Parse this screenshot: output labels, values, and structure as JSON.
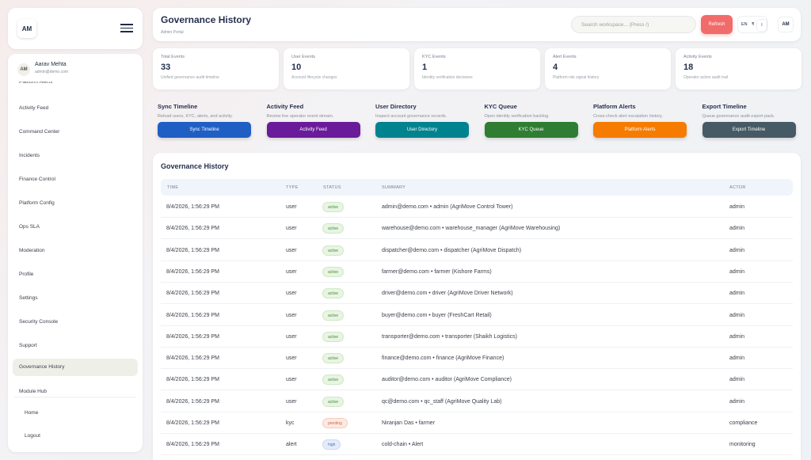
{
  "brand": {
    "logo": "AM",
    "menu_icon": "hamburger-icon"
  },
  "user": {
    "initials": "AM",
    "name": "Aarav Mehta",
    "email": "admin@demo.com"
  },
  "sidebar": {
    "cut_item": "Platform Alerts",
    "items": [
      {
        "label": "Activity Feed"
      },
      {
        "label": "Command Center"
      },
      {
        "label": "Incidents"
      },
      {
        "label": "Finance Control"
      },
      {
        "label": "Platform Config"
      },
      {
        "label": "Ops SLA"
      },
      {
        "label": "Moderation"
      },
      {
        "label": "Profile"
      },
      {
        "label": "Settings"
      },
      {
        "label": "Security Console"
      },
      {
        "label": "Support"
      },
      {
        "label": "Governance History",
        "active": true
      },
      {
        "label": "Module Hub"
      }
    ],
    "bottom": [
      {
        "label": "Home"
      },
      {
        "label": "Logout"
      }
    ]
  },
  "header": {
    "title": "Governance History",
    "subtitle": "Admin Portal",
    "search_placeholder": "Search workspace... (Press /)",
    "refresh_label": "Refresh",
    "lang": "EN",
    "currency": "₹",
    "currency_sub": "I",
    "avatar": "AM"
  },
  "stats": [
    {
      "label": "Total Events",
      "value": "33",
      "desc": "Unified governance audit timeline"
    },
    {
      "label": "User Events",
      "value": "10",
      "desc": "Account lifecycle changes"
    },
    {
      "label": "KYC Events",
      "value": "1",
      "desc": "Identity verification decisions"
    },
    {
      "label": "Alert Events",
      "value": "4",
      "desc": "Platform risk signal history"
    },
    {
      "label": "Activity Events",
      "value": "18",
      "desc": "Operator action audit trail"
    }
  ],
  "actions": [
    {
      "title": "Sync Timeline",
      "desc": "Reload users, KYC, alerts, and activity.",
      "button": "Sync Timeline",
      "color": "#1f5fc4"
    },
    {
      "title": "Activity Feed",
      "desc": "Review live operator event stream.",
      "button": "Activity Feed",
      "color": "#6a1b9a"
    },
    {
      "title": "User Directory",
      "desc": "Inspect account governance records.",
      "button": "User Directory",
      "color": "#00838f"
    },
    {
      "title": "KYC Queue",
      "desc": "Open identity verification backlog.",
      "button": "KYC Queue",
      "color": "#2e7d32"
    },
    {
      "title": "Platform Alerts",
      "desc": "Cross-check alert escalation history.",
      "button": "Platform Alerts",
      "color": "#f57c00"
    },
    {
      "title": "Export Timeline",
      "desc": "Queue governance audit export pack.",
      "button": "Export Timeline",
      "color": "#455a64"
    }
  ],
  "history": {
    "title": "Governance History",
    "columns": {
      "time": "TIME",
      "type": "TYPE",
      "status": "STATUS",
      "summary": "SUMMARY",
      "actor": "ACTOR"
    },
    "rows": [
      {
        "time": "8/4/2026, 1:56:29 PM",
        "type": "user",
        "status": "active",
        "summary": "admin@demo.com • admin (AgriMove Control Tower)",
        "actor": "admin"
      },
      {
        "time": "8/4/2026, 1:56:29 PM",
        "type": "user",
        "status": "active",
        "summary": "warehouse@demo.com • warehouse_manager (AgriMove Warehousing)",
        "actor": "admin"
      },
      {
        "time": "8/4/2026, 1:56:29 PM",
        "type": "user",
        "status": "active",
        "summary": "dispatcher@demo.com • dispatcher (AgriMove Dispatch)",
        "actor": "admin"
      },
      {
        "time": "8/4/2026, 1:56:29 PM",
        "type": "user",
        "status": "active",
        "summary": "farmer@demo.com • farmer (Kishore Farms)",
        "actor": "admin"
      },
      {
        "time": "8/4/2026, 1:56:29 PM",
        "type": "user",
        "status": "active",
        "summary": "driver@demo.com • driver (AgriMove Driver Network)",
        "actor": "admin"
      },
      {
        "time": "8/4/2026, 1:56:29 PM",
        "type": "user",
        "status": "active",
        "summary": "buyer@demo.com • buyer (FreshCart Retail)",
        "actor": "admin"
      },
      {
        "time": "8/4/2026, 1:56:29 PM",
        "type": "user",
        "status": "active",
        "summary": "transporter@demo.com • transporter (Shaikh Logistics)",
        "actor": "admin"
      },
      {
        "time": "8/4/2026, 1:56:29 PM",
        "type": "user",
        "status": "active",
        "summary": "finance@demo.com • finance (AgriMove Finance)",
        "actor": "admin"
      },
      {
        "time": "8/4/2026, 1:56:29 PM",
        "type": "user",
        "status": "active",
        "summary": "auditor@demo.com • auditor (AgriMove Compliance)",
        "actor": "admin"
      },
      {
        "time": "8/4/2026, 1:56:29 PM",
        "type": "user",
        "status": "active",
        "summary": "qc@demo.com • qc_staff (AgriMove Quality Lab)",
        "actor": "admin"
      },
      {
        "time": "8/4/2026, 1:56:29 PM",
        "type": "kyc",
        "status": "pending",
        "summary": "Niranjan Das • farmer",
        "actor": "compliance"
      },
      {
        "time": "8/4/2026, 1:56:29 PM",
        "type": "alert",
        "status": "high",
        "summary": "cold-chain • Alert",
        "actor": "monitoring"
      }
    ]
  }
}
